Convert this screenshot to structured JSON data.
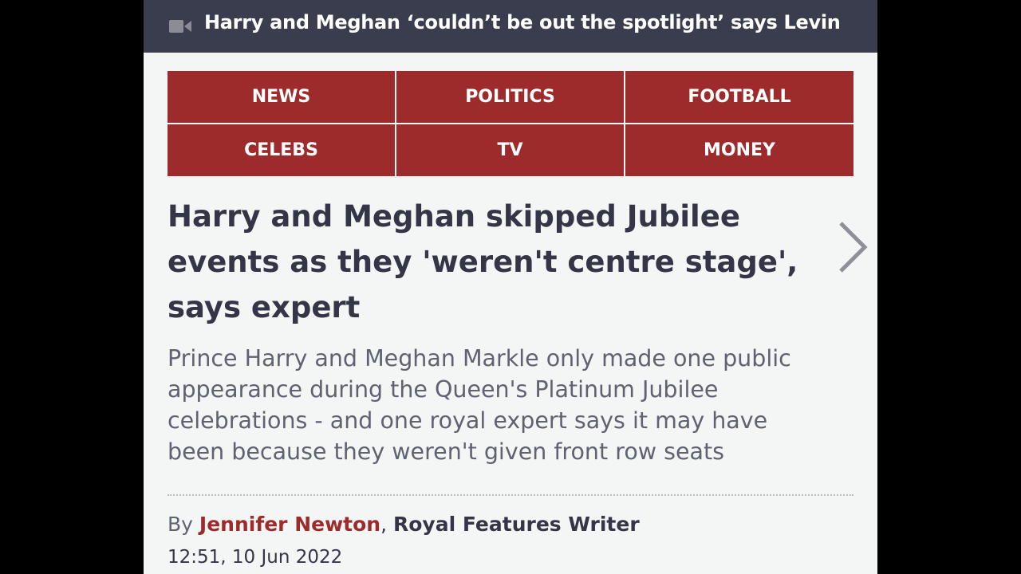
{
  "top_bar": {
    "icon": "video-camera-icon",
    "title": "Harry and Meghan ‘couldn’t be out the spotlight’ says Levin"
  },
  "nav": {
    "items": [
      {
        "label": "NEWS"
      },
      {
        "label": "POLITICS"
      },
      {
        "label": "FOOTBALL"
      },
      {
        "label": "CELEBS"
      },
      {
        "label": "TV"
      },
      {
        "label": "MONEY"
      }
    ]
  },
  "article": {
    "headline_lines": [
      "Harry and Meghan skipped Jubilee",
      "events as they 'weren't centre stage',",
      "says expert"
    ],
    "standfirst_lines": [
      "Prince Harry and Meghan Markle only made one public",
      "appearance during the Queen's Platinum Jubilee",
      "celebrations - and one royal expert says it may have",
      "been because they weren't given front row seats"
    ],
    "byline": {
      "prefix": "By ",
      "author": "Jennifer Newton",
      "separator": ", ",
      "role": "Royal Features Writer"
    },
    "timestamp": "12:51, 10 Jun 2022",
    "next_icon": "chevron-right-icon"
  },
  "colors": {
    "brand_red": "#9e2b2b",
    "top_bar_bg": "#3a3d4e",
    "headline": "#343647",
    "standfirst": "#5f6270",
    "page_bg": "#f4f5f5"
  }
}
